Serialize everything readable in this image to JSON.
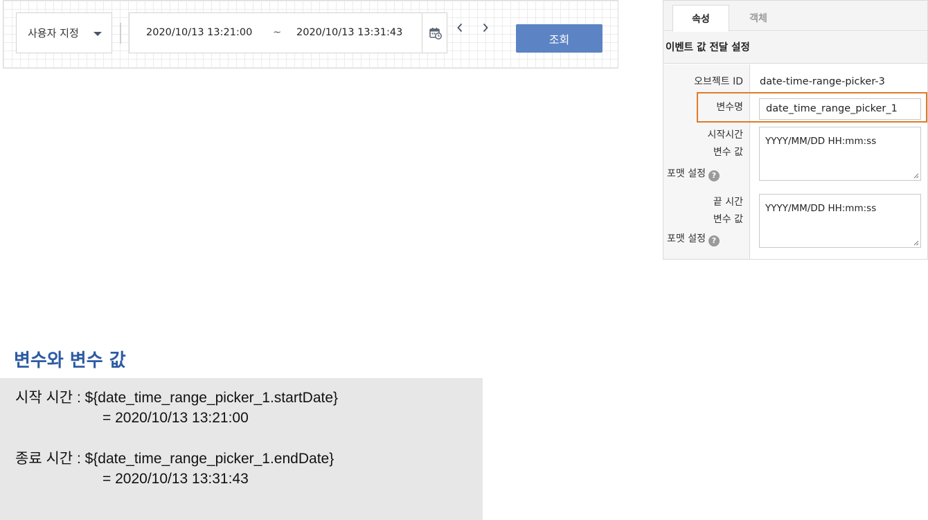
{
  "widget": {
    "period_select": {
      "value": "사용자 지정"
    },
    "range": {
      "start": "2020/10/13 13:21:00",
      "separator": "~",
      "end": "2020/10/13 13:31:43"
    },
    "icons": {
      "calendar": "calendar-clock-icon",
      "prev": "chevron-left-icon",
      "next": "chevron-right-icon",
      "dropdown": "caret-down-icon"
    },
    "query_button": "조회",
    "colors": {
      "query_button": "#5c84c4"
    }
  },
  "panel": {
    "tabs": [
      {
        "label": "속성",
        "active": true
      },
      {
        "label": "객체",
        "active": false
      }
    ],
    "section_title": "이벤트 값 전달 설정",
    "object_id": {
      "label": "오브젝트 ID",
      "value": "date-time-range-picker-3"
    },
    "variable_name": {
      "label": "변수명",
      "value": "date_time_range_picker_1"
    },
    "start_format": {
      "label_line1": "시작시간",
      "label_line2": "변수 값",
      "label_line3": "포맷 설정",
      "value": "YYYY/MM/DD HH:mm:ss"
    },
    "end_format": {
      "label_line1": "끝 시간",
      "label_line2": "변수 값",
      "label_line3": "포맷 설정",
      "value": "YYYY/MM/DD HH:mm:ss"
    },
    "help_glyph": "?",
    "colors": {
      "highlight": "#e07a26"
    }
  },
  "explain": {
    "heading": "변수와 변수 값",
    "start_line": "시작 시간 : ${date_time_range_picker_1.startDate}",
    "start_value": "= 2020/10/13 13:21:00",
    "end_line": "종료 시간 : ${date_time_range_picker_1.endDate}",
    "end_value": "= 2020/10/13 13:31:43",
    "colors": {
      "heading": "#2d5aa3"
    }
  }
}
